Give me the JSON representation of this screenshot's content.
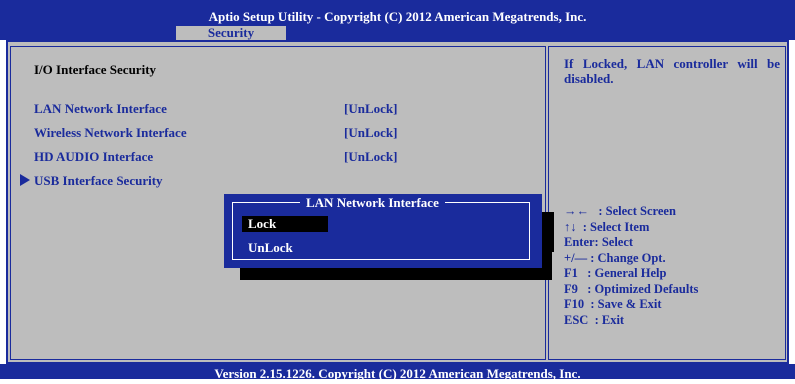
{
  "header": {
    "title": "Aptio Setup Utility - Copyright (C) 2012 American Megatrends, Inc.",
    "active_tab": "Security"
  },
  "main": {
    "heading": "I/O Interface Security",
    "items": [
      {
        "label": "LAN Network Interface",
        "value": "[UnLock]"
      },
      {
        "label": "Wireless Network Interface",
        "value": "[UnLock]"
      },
      {
        "label": "HD AUDIO Interface",
        "value": "[UnLock]"
      },
      {
        "label": "USB Interface Security"
      }
    ]
  },
  "help": {
    "text": "If Locked, LAN controller will be disabled."
  },
  "keys": [
    "→←   : Select Screen",
    "↑↓  : Select Item",
    "Enter: Select",
    "+/— : Change Opt.",
    "F1   : General Help",
    "F9   : Optimized Defaults",
    "F10  : Save & Exit",
    "ESC  : Exit"
  ],
  "popup": {
    "title": "LAN Network Interface",
    "options": [
      "Lock",
      "UnLock"
    ],
    "selected": "Lock"
  },
  "footer": {
    "text": "Version 2.15.1226. Copyright (C) 2012 American Megatrends, Inc."
  },
  "colors": {
    "bios_blue": "#1a2b9c",
    "panel_gray": "#bdbdbd"
  }
}
